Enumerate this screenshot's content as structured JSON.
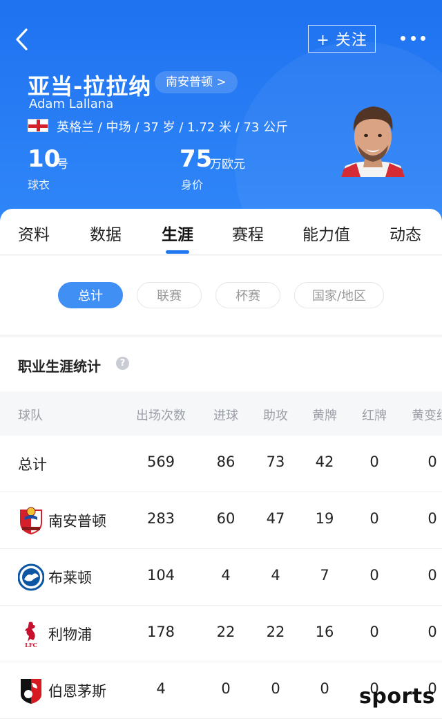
{
  "header": {
    "follow_label": "+ 关注",
    "player_name": "亚当-拉拉纳",
    "club_pill": "南安普顿 >",
    "player_name_en": "Adam Lallana",
    "meta": "英格兰 / 中场 / 37 岁 / 1.72 米 / 73 公斤",
    "jersey_number": "10",
    "jersey_unit": "号",
    "jersey_label": "球衣",
    "value_number": "75",
    "value_unit": "万欧元",
    "value_label": "身价"
  },
  "tabs": [
    {
      "label": "资料"
    },
    {
      "label": "数据"
    },
    {
      "label": "生涯"
    },
    {
      "label": "赛程"
    },
    {
      "label": "能力值"
    },
    {
      "label": "动态"
    }
  ],
  "active_tab": "生涯",
  "filters": [
    {
      "label": "总计"
    },
    {
      "label": "联赛"
    },
    {
      "label": "杯赛"
    },
    {
      "label": "国家/地区"
    }
  ],
  "section": {
    "title": "职业生涯统计",
    "help": "?"
  },
  "table": {
    "headers": [
      "球队",
      "出场次数",
      "进球",
      "助攻",
      "黄牌",
      "红牌",
      "黄变红"
    ],
    "rows": [
      {
        "team": "总计",
        "apps": "569",
        "goals": "86",
        "assists": "73",
        "yellow": "42",
        "red": "0",
        "second_yellow": "0"
      },
      {
        "team": "南安普顿",
        "apps": "283",
        "goals": "60",
        "assists": "47",
        "yellow": "19",
        "red": "0",
        "second_yellow": "0"
      },
      {
        "team": "布莱顿",
        "apps": "104",
        "goals": "4",
        "assists": "4",
        "yellow": "7",
        "red": "0",
        "second_yellow": "0"
      },
      {
        "team": "利物浦",
        "apps": "178",
        "goals": "22",
        "assists": "22",
        "yellow": "16",
        "red": "0",
        "second_yellow": "0"
      },
      {
        "team": "伯恩茅斯",
        "apps": "4",
        "goals": "0",
        "assists": "0",
        "yellow": "0",
        "red": "0",
        "second_yellow": "0"
      }
    ]
  },
  "watermark": "sports",
  "colors": {
    "header_blue": "#1f72f0",
    "accent_blue": "#3f8ff5",
    "tab_indicator": "#1f78f0"
  }
}
